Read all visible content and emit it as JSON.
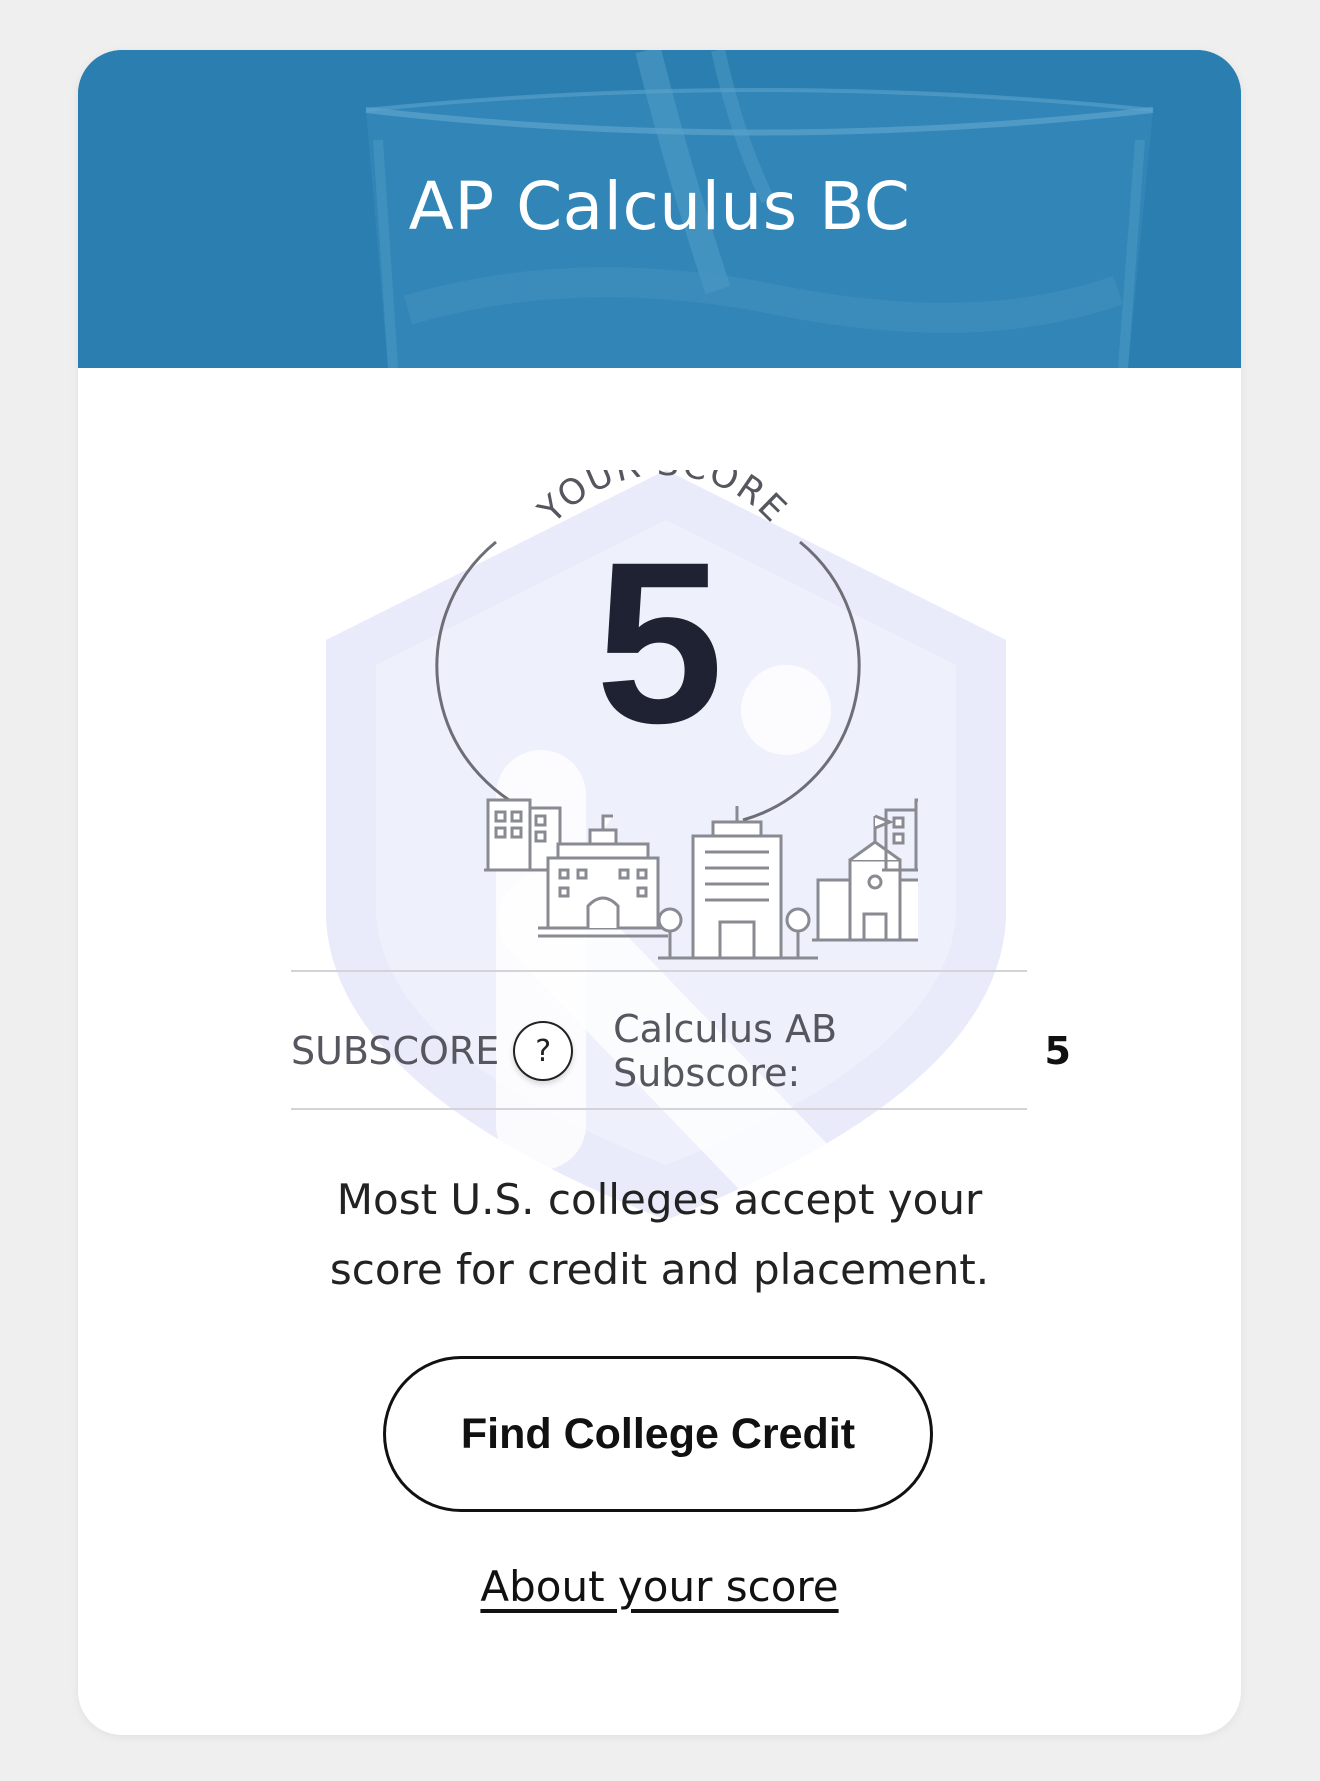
{
  "header": {
    "title": "AP Calculus BC"
  },
  "score": {
    "arc_label": "YOUR SCORE",
    "value": "5"
  },
  "subscore": {
    "label": "SUBSCORE",
    "help_glyph": "?",
    "name": "Calculus AB Subscore:",
    "value": "5"
  },
  "message": {
    "line1": "Most U.S. colleges accept your",
    "line2": "score for credit and placement."
  },
  "actions": {
    "find_credit_label": "Find College Credit",
    "about_link_label": "About your score"
  },
  "colors": {
    "header_blue": "#2b7fb0",
    "watermark": "#e6e8fb",
    "text_dark": "#1f2233"
  },
  "icons": [
    "question-icon",
    "city-buildings-illustration",
    "shield-watermark"
  ]
}
